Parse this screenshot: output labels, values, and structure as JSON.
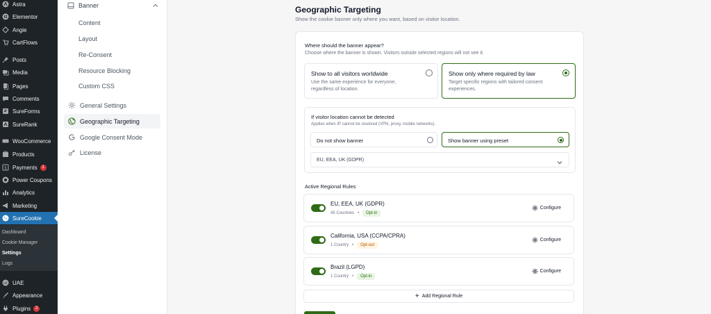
{
  "wp_menu": {
    "items": [
      {
        "label": "Astra",
        "icon": "astra-icon"
      },
      {
        "label": "Elementor",
        "icon": "elementor-icon"
      },
      {
        "label": "Angie",
        "icon": "angie-icon"
      },
      {
        "label": "CartFlows",
        "icon": "cartflows-icon"
      },
      {
        "label": "Posts",
        "icon": "pin-icon"
      },
      {
        "label": "Media",
        "icon": "media-icon"
      },
      {
        "label": "Pages",
        "icon": "pages-icon"
      },
      {
        "label": "Comments",
        "icon": "comments-icon"
      },
      {
        "label": "SureForms",
        "icon": "sureforms-icon"
      },
      {
        "label": "SureRank",
        "icon": "surerank-icon"
      },
      {
        "label": "WooCommerce",
        "icon": "woocommerce-icon"
      },
      {
        "label": "Products",
        "icon": "products-icon"
      },
      {
        "label": "Payments",
        "icon": "payments-icon",
        "badge": "1"
      },
      {
        "label": "Power Coupons",
        "icon": "coupon-icon"
      },
      {
        "label": "Analytics",
        "icon": "analytics-icon"
      },
      {
        "label": "Marketing",
        "icon": "megaphone-icon"
      },
      {
        "label": "SureCookie",
        "icon": "surecookie-icon"
      },
      {
        "label": "UAE",
        "icon": "uae-icon"
      },
      {
        "label": "Appearance",
        "icon": "appearance-icon"
      },
      {
        "label": "Plugins",
        "icon": "plugins-icon",
        "badge": "2"
      }
    ],
    "submenu": [
      "Dashboard",
      "Cookie Manager",
      "Settings",
      "Logs"
    ]
  },
  "plugin_nav": {
    "group_header": "Banner",
    "group_children": [
      "Content",
      "Layout",
      "Re-Consent",
      "Resource Blocking",
      "Custom CSS"
    ],
    "items": [
      {
        "label": "General Settings",
        "icon": "gear-icon"
      },
      {
        "label": "Geographic Targeting",
        "icon": "globe-icon"
      },
      {
        "label": "Google Consent Mode",
        "icon": "google-icon"
      },
      {
        "label": "License",
        "icon": "key-icon"
      }
    ]
  },
  "page": {
    "title": "Geographic Targeting",
    "subtitle": "Show the cookie banner only where you want, based on visitor location."
  },
  "appear": {
    "question": "Where should the banner appear?",
    "help": "Choose where the banner is shown. Visitors outside selected regions will not see it.",
    "option_all_title": "Show to all visitors worldwide",
    "option_all_desc_1": "Use the same experience for everyone,",
    "option_all_desc_2": "regardless of location.",
    "option_law_title": "Show only where required by law",
    "option_law_desc_1": "Target specific regions with tailored consent",
    "option_law_desc_2": "experiences."
  },
  "fallback": {
    "title": "If visitor location cannot be detected",
    "help": "Applies when IP cannot be resolved (VPN, proxy, mobile networks).",
    "option_hide": "Do not show banner",
    "option_preset": "Show banner using preset",
    "preset_value": "EU, EEA, UK (GDPR)"
  },
  "rules": {
    "heading": "Active Regional Rules",
    "configure_label": "Configure",
    "add_label": "Add Regional Rule",
    "items": [
      {
        "name": "EU, EEA, UK (GDPR)",
        "count": "45 Countries",
        "mode": "Opt-in"
      },
      {
        "name": "California, USA (CCPA/CPRA)",
        "count": "1 Country",
        "mode": "Opt-out"
      },
      {
        "name": "Brazil (LGPD)",
        "count": "1 Country",
        "mode": "Opt-in"
      }
    ]
  },
  "colors": {
    "accent": "#2f6b16",
    "wp_sidebar": "#1d2327",
    "wp_active": "#2271b1"
  }
}
